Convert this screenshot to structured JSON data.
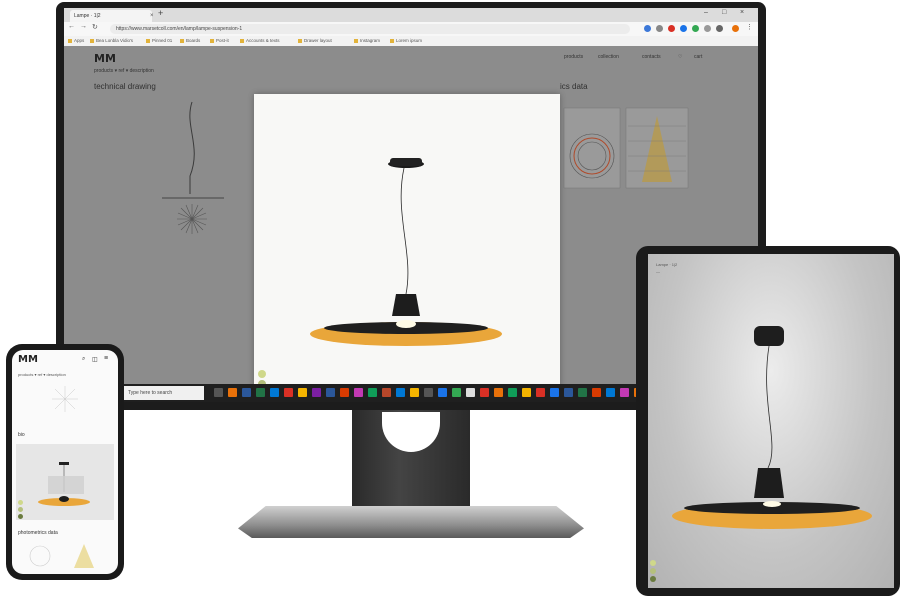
{
  "browser": {
    "tab_title": "Lampe · 1|2",
    "tab_close": "×",
    "new_tab": "+",
    "window_controls": [
      "–",
      "□",
      "×"
    ],
    "nav": [
      "←",
      "→",
      "↻"
    ],
    "url": "https://www.marsetcoll.com/en/lamp/lampe-suspension-1",
    "bookmarks": [
      "Apps",
      "Bea Lonbla Vidio's",
      "Pinned 01",
      "Boards",
      "Post-it",
      "Accounts & texts",
      "Drawer layout",
      "Instagram",
      "Lorem ipsum"
    ]
  },
  "site": {
    "logo": "MM",
    "breadcrumb": "products ▾  ref ▾  description",
    "left_heading": "technical drawing",
    "right_heading": "ics data",
    "menu": [
      "products",
      "collection",
      "contacts",
      "♡",
      "cart"
    ]
  },
  "taskbar": {
    "search_placeholder": "Type here to search"
  },
  "colors": {
    "shade": "#e9a63a",
    "swatch_light": "#cfd88a",
    "swatch_mid": "#b5c07c",
    "swatch_dark": "#6a7b3f",
    "taskbar": "#1f1f1f"
  },
  "tablet": {
    "title": "Lampe · 1|2",
    "subtitle": "—"
  },
  "phone": {
    "logo": "MM",
    "breadcrumb": "products ▾  ref ▾  description",
    "label_top": "bio",
    "label_bottom": "photometrics data"
  }
}
